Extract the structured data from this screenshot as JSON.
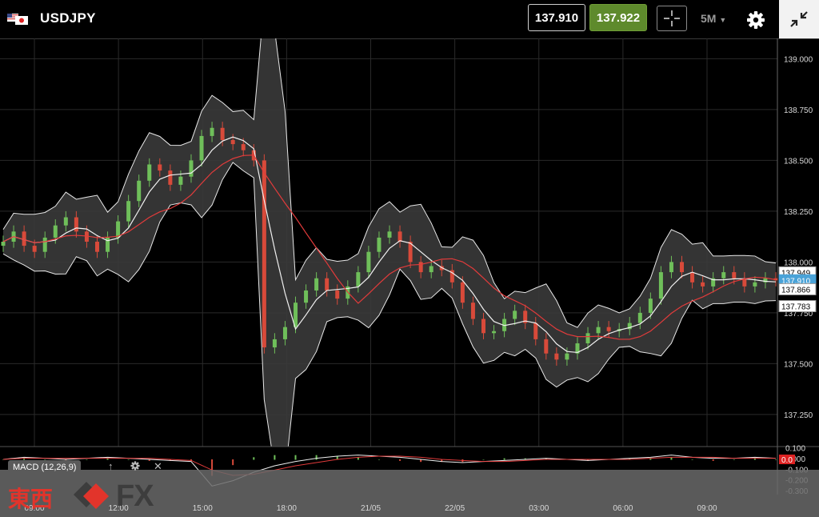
{
  "header": {
    "symbol": "USDJPY",
    "bid": "137.910",
    "ask": "137.922",
    "timeframe": "5M",
    "icons": [
      "us-jp-flag-icon",
      "crosshair-icon",
      "chevron-down-icon",
      "gear-icon",
      "collapse-icon"
    ]
  },
  "colors": {
    "ask_bg": "#5e8a2c",
    "last_price_tag": "#4aa3d8",
    "macd_signal": "#e23b3b",
    "up_candle": "#6fbf5a",
    "down_candle": "#d84a3a",
    "band_fill": "#3a3a3a"
  },
  "chart_data": {
    "type": "candlestick",
    "y_ticks": [
      "139.000",
      "138.750",
      "138.500",
      "138.250",
      "138.000",
      "137.750",
      "137.500",
      "137.250"
    ],
    "x_ticks": [
      "09:00",
      "12:00",
      "15:00",
      "18:00",
      "21/05",
      "22/05",
      "03:00",
      "06:00",
      "09:00"
    ],
    "ylim": [
      137.1,
      139.1
    ],
    "price_tags": [
      {
        "label": "137.949",
        "value": 137.949,
        "style": "white"
      },
      {
        "label": "137.910",
        "value": 137.91,
        "style": "blue"
      },
      {
        "label": "137.866",
        "value": 137.866,
        "style": "white"
      },
      {
        "label": "137.783",
        "value": 137.783,
        "style": "white"
      }
    ],
    "close_series": [
      138.1,
      138.15,
      138.08,
      138.05,
      138.12,
      138.18,
      138.22,
      138.15,
      138.1,
      138.05,
      138.12,
      138.2,
      138.3,
      138.4,
      138.48,
      138.45,
      138.38,
      138.42,
      138.5,
      138.62,
      138.66,
      138.6,
      138.58,
      138.55,
      138.5,
      137.58,
      137.62,
      137.68,
      137.8,
      137.86,
      137.92,
      137.86,
      137.82,
      137.88,
      137.95,
      138.05,
      138.12,
      138.15,
      138.1,
      138.0,
      137.95,
      137.98,
      137.96,
      137.9,
      137.8,
      137.72,
      137.65,
      137.66,
      137.72,
      137.76,
      137.7,
      137.62,
      137.55,
      137.52,
      137.55,
      137.6,
      137.65,
      137.68,
      137.66,
      137.67,
      137.7,
      137.75,
      137.82,
      137.95,
      138.0,
      137.95,
      137.9,
      137.88,
      137.92,
      137.95,
      137.92,
      137.88,
      137.9,
      137.92,
      137.91
    ],
    "macd": {
      "label": "MACD (12,26,9)",
      "y_ticks": [
        "0.100",
        "0.000",
        "-0.100",
        "-0.200",
        "-0.300"
      ],
      "value_tag": "0.0",
      "ylim": [
        -0.33,
        0.12
      ],
      "macd_series": [
        0.0,
        0.02,
        0.01,
        0.0,
        0.01,
        0.02,
        0.01,
        0.0,
        -0.01,
        -0.02,
        -0.25,
        -0.2,
        -0.12,
        -0.06,
        -0.02,
        0.01,
        0.03,
        0.04,
        0.03,
        0.02,
        0.0,
        -0.02,
        -0.03,
        -0.02,
        -0.01,
        0.0,
        0.01,
        0.0,
        -0.01,
        0.0,
        0.01,
        0.02,
        0.04,
        0.02,
        0.01,
        0.01,
        0.02,
        0.01
      ],
      "signal_series": [
        0.0,
        0.01,
        0.01,
        0.01,
        0.01,
        0.01,
        0.01,
        0.01,
        0.0,
        -0.01,
        -0.1,
        -0.15,
        -0.14,
        -0.1,
        -0.06,
        -0.03,
        0.0,
        0.02,
        0.03,
        0.03,
        0.02,
        0.0,
        -0.01,
        -0.02,
        -0.02,
        -0.01,
        0.0,
        0.0,
        0.0,
        0.0,
        0.0,
        0.01,
        0.02,
        0.02,
        0.02,
        0.01,
        0.01,
        0.01
      ]
    }
  },
  "macd_controls": {
    "up": "↑",
    "close": "✕"
  },
  "logo": {
    "kanji": "東西",
    "fx": "FX"
  }
}
